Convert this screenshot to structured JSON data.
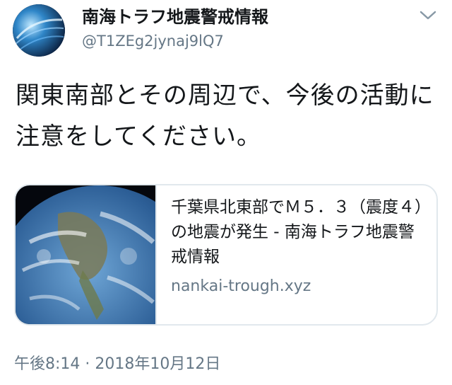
{
  "user": {
    "display_name": "南海トラフ地震警戒情報",
    "handle": "@T1ZEg2jynaj9lQ7",
    "avatar_icon": "globe-avatar"
  },
  "menu": {
    "caret_icon": "chevron-down-icon"
  },
  "tweet": {
    "text": "関東南部とその周辺で、今後の活動に注意をしてください。"
  },
  "card": {
    "image_icon": "earth-image",
    "title": "千葉県北東部でＭ５．３（震度４）の地震が発生 - 南海トラフ地震警戒情報",
    "domain": "nankai-trough.xyz"
  },
  "meta": {
    "timestamp": "午後8:14 · 2018年10月12日"
  },
  "colors": {
    "text": "#14171a",
    "secondary": "#657786",
    "border": "#e1e8ed"
  }
}
